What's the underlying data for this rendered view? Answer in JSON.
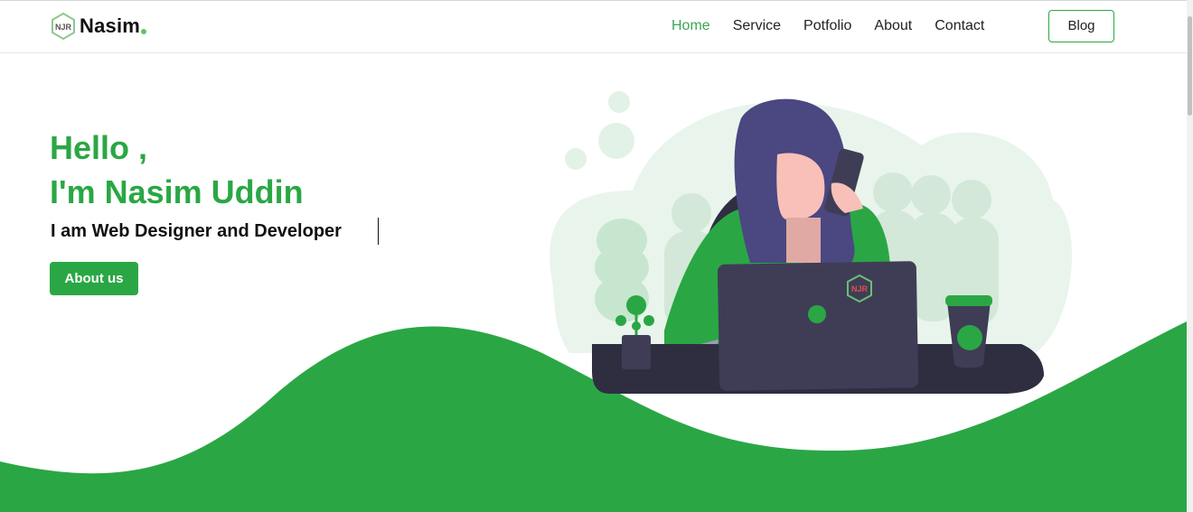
{
  "brand": {
    "name": "Nasim",
    "mark_text": "NJR",
    "accent": "#2aa744",
    "dot_color": "#5cc46b"
  },
  "nav": {
    "items": [
      {
        "label": "Home",
        "active": true
      },
      {
        "label": "Service",
        "active": false
      },
      {
        "label": "Potfolio",
        "active": false
      },
      {
        "label": "About",
        "active": false
      },
      {
        "label": "Contact",
        "active": false
      }
    ],
    "blog_label": "Blog"
  },
  "hero": {
    "greeting": "Hello ,",
    "name_line": "I'm Nasim Uddin",
    "subtitle": "I am Web Designer and Developer",
    "cta_label": "About us"
  },
  "illustration": {
    "laptop_logo_text": "NJR",
    "icon": "woman-at-laptop-illustration"
  }
}
